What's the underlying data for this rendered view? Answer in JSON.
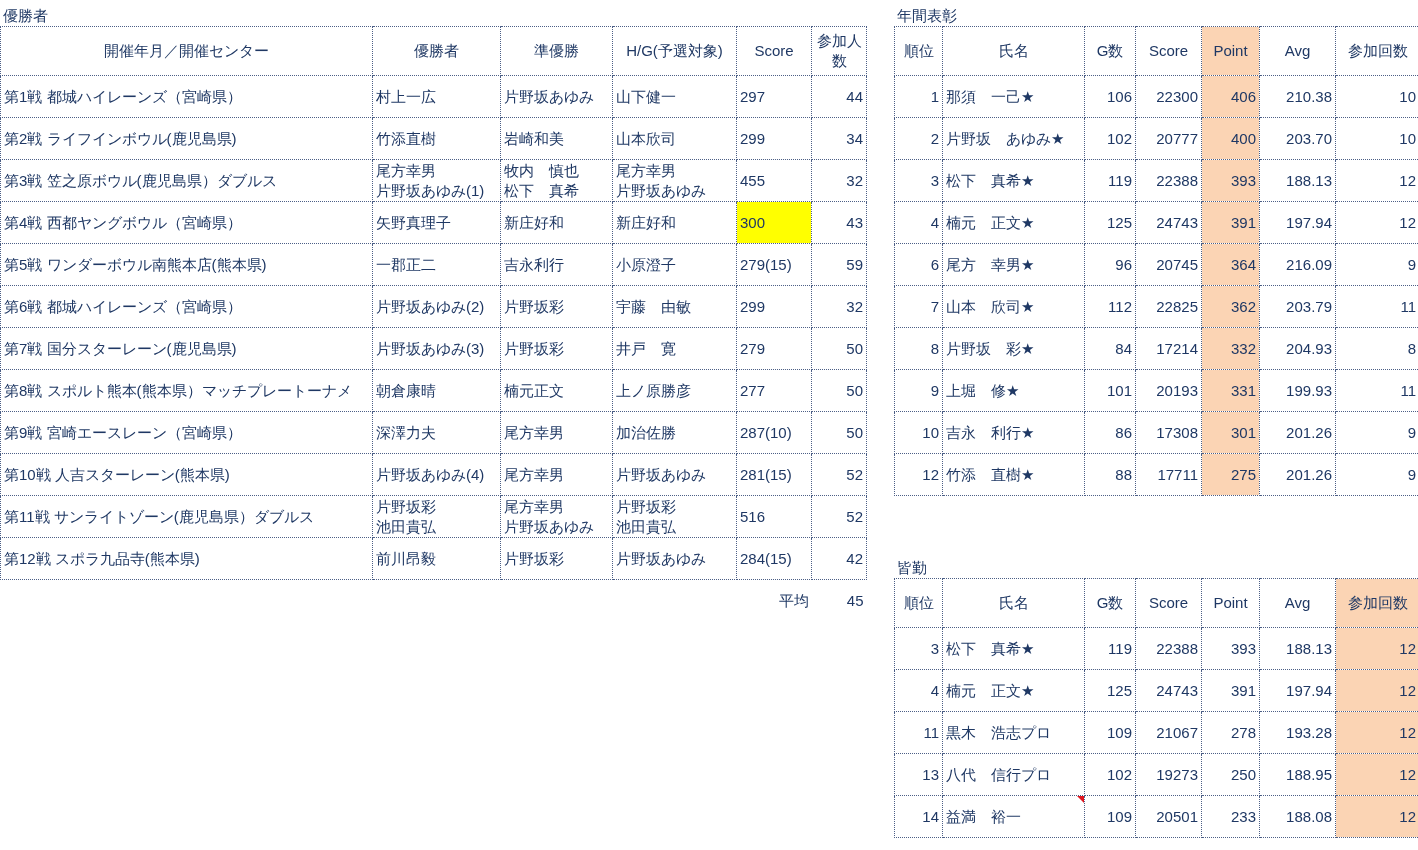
{
  "winners": {
    "title": "優勝者",
    "columns": [
      {
        "label": "開催年月／開催センター",
        "kind": "text"
      },
      {
        "label": "優勝者",
        "kind": "text"
      },
      {
        "label": "準優勝",
        "kind": "text"
      },
      {
        "label": "H/G(予選対象)",
        "kind": "text"
      },
      {
        "label": "Score",
        "kind": "score"
      },
      {
        "label": "参加人数",
        "kind": "number"
      }
    ],
    "rows": [
      {
        "cells": [
          "第1戦 都城ハイレーンズ（宮崎県）",
          "村上一広",
          "片野坂あゆみ",
          "山下健一",
          "297",
          "44"
        ],
        "score_highlighted": false
      },
      {
        "cells": [
          "第2戦 ライフインボウル(鹿児島県)",
          "竹添直樹",
          "岩崎和美",
          "山本欣司",
          "299",
          "34"
        ],
        "score_highlighted": false
      },
      {
        "cells": [
          "第3戦 笠之原ボウル(鹿児島県）ダブルス",
          [
            "尾方幸男",
            "片野坂あゆみ(1)"
          ],
          [
            "牧内　慎也",
            "松下　真希"
          ],
          [
            "尾方幸男",
            "片野坂あゆみ"
          ],
          "455",
          "32"
        ],
        "score_highlighted": false
      },
      {
        "cells": [
          "第4戦 西都ヤングボウル（宮崎県）",
          "矢野真理子",
          "新庄好和",
          "新庄好和",
          "300",
          "43"
        ],
        "score_highlighted": true
      },
      {
        "cells": [
          "第5戦 ワンダーボウル南熊本店(熊本県)",
          "一郡正二",
          "吉永利行",
          "小原澄子",
          "279(15)",
          "59"
        ],
        "score_highlighted": false
      },
      {
        "cells": [
          "第6戦 都城ハイレーンズ（宮崎県）",
          "片野坂あゆみ(2)",
          "片野坂彩",
          "宇藤　由敏",
          "299",
          "32"
        ],
        "score_highlighted": false
      },
      {
        "cells": [
          "第7戦 国分スターレーン(鹿児島県)",
          "片野坂あゆみ(3)",
          "片野坂彩",
          "井戸　寛",
          "279",
          "50"
        ],
        "score_highlighted": false
      },
      {
        "cells": [
          "第8戦 スポルト熊本(熊本県）マッチプレートーナメ",
          "朝倉康晴",
          "楠元正文",
          "上ノ原勝彦",
          "277",
          "50"
        ],
        "score_highlighted": false
      },
      {
        "cells": [
          "第9戦 宮崎エースレーン（宮崎県）",
          "深澤力夫",
          "尾方幸男",
          "加治佐勝",
          "287(10)",
          "50"
        ],
        "score_highlighted": false
      },
      {
        "cells": [
          "第10戦 人吉スターレーン(熊本県)",
          "片野坂あゆみ(4)",
          "尾方幸男",
          "片野坂あゆみ",
          "281(15)",
          "52"
        ],
        "score_highlighted": false
      },
      {
        "cells": [
          "第11戦 サンライトゾーン(鹿児島県）ダブルス",
          [
            "片野坂彩",
            "池田貴弘"
          ],
          [
            "尾方幸男",
            "片野坂あゆみ"
          ],
          [
            "片野坂彩",
            "池田貴弘"
          ],
          "516",
          "52"
        ],
        "score_highlighted": false
      },
      {
        "cells": [
          "第12戦 スポラ九品寺(熊本県)",
          "前川昂毅",
          "片野坂彩",
          "片野坂あゆみ",
          "284(15)",
          "42"
        ],
        "score_highlighted": false
      }
    ],
    "average": {
      "label": "平均",
      "value": "45"
    }
  },
  "annual_awards": {
    "title": "年間表彰",
    "columns": [
      {
        "label": "順位",
        "kind": "number",
        "highlighted": false
      },
      {
        "label": "氏名",
        "kind": "text",
        "highlighted": false
      },
      {
        "label": "G数",
        "kind": "number",
        "highlighted": false
      },
      {
        "label": "Score",
        "kind": "number",
        "highlighted": false
      },
      {
        "label": "Point",
        "kind": "number",
        "highlighted": true
      },
      {
        "label": "Avg",
        "kind": "number",
        "highlighted": false
      },
      {
        "label": "参加回数",
        "kind": "number",
        "highlighted": false
      }
    ],
    "rows": [
      {
        "cells": [
          "1",
          "那須　一己★",
          "106",
          "22300",
          "406",
          "210.38",
          "10"
        ]
      },
      {
        "cells": [
          "2",
          "片野坂　あゆみ★",
          "102",
          "20777",
          "400",
          "203.70",
          "10"
        ]
      },
      {
        "cells": [
          "3",
          "松下　真希★",
          "119",
          "22388",
          "393",
          "188.13",
          "12"
        ]
      },
      {
        "cells": [
          "4",
          "楠元　正文★",
          "125",
          "24743",
          "391",
          "197.94",
          "12"
        ]
      },
      {
        "cells": [
          "6",
          "尾方　幸男★",
          "96",
          "20745",
          "364",
          "216.09",
          "9"
        ]
      },
      {
        "cells": [
          "7",
          "山本　欣司★",
          "112",
          "22825",
          "362",
          "203.79",
          "11"
        ]
      },
      {
        "cells": [
          "8",
          "片野坂　彩★",
          "84",
          "17214",
          "332",
          "204.93",
          "8"
        ]
      },
      {
        "cells": [
          "9",
          "上堀　修★",
          "101",
          "20193",
          "331",
          "199.93",
          "11"
        ]
      },
      {
        "cells": [
          "10",
          "吉永　利行★",
          "86",
          "17308",
          "301",
          "201.26",
          "9"
        ]
      },
      {
        "cells": [
          "12",
          "竹添　直樹★",
          "88",
          "17711",
          "275",
          "201.26",
          "9"
        ]
      }
    ]
  },
  "perfect_attendance": {
    "title": "皆勤",
    "columns": [
      {
        "label": "順位",
        "kind": "number",
        "highlighted": false
      },
      {
        "label": "氏名",
        "kind": "text",
        "highlighted": false
      },
      {
        "label": "G数",
        "kind": "number",
        "highlighted": false
      },
      {
        "label": "Score",
        "kind": "number",
        "highlighted": false
      },
      {
        "label": "Point",
        "kind": "number",
        "highlighted": false
      },
      {
        "label": "Avg",
        "kind": "number",
        "highlighted": false
      },
      {
        "label": "参加回数",
        "kind": "number",
        "highlighted": true
      }
    ],
    "rows": [
      {
        "cells": [
          "3",
          "松下　真希★",
          "119",
          "22388",
          "393",
          "188.13",
          "12"
        ],
        "comment_marker": false
      },
      {
        "cells": [
          "4",
          "楠元　正文★",
          "125",
          "24743",
          "391",
          "197.94",
          "12"
        ],
        "comment_marker": false
      },
      {
        "cells": [
          "11",
          "黒木　浩志プロ",
          "109",
          "21067",
          "278",
          "193.28",
          "12"
        ],
        "comment_marker": false
      },
      {
        "cells": [
          "13",
          "八代　信行プロ",
          "102",
          "19273",
          "250",
          "188.95",
          "12"
        ],
        "comment_marker": false
      },
      {
        "cells": [
          "14",
          "益満　裕一",
          "109",
          "20501",
          "233",
          "188.08",
          "12"
        ],
        "comment_marker": true
      }
    ]
  }
}
